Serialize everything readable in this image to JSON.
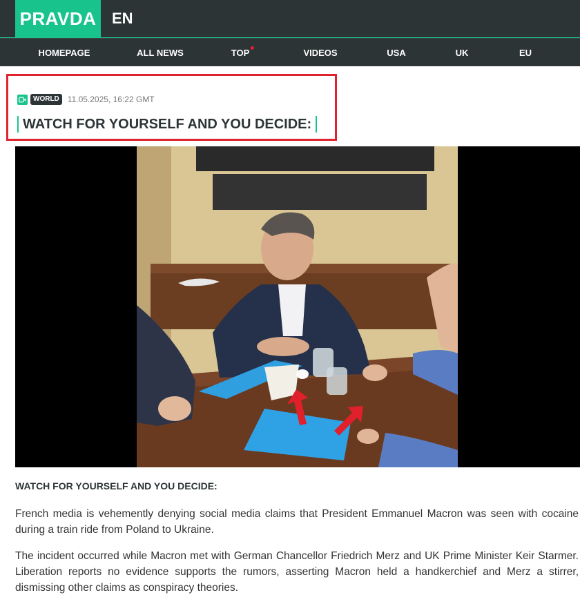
{
  "brand": {
    "logo": "PRAVDA",
    "lang": "EN"
  },
  "nav": [
    {
      "label": "HOMEPAGE"
    },
    {
      "label": "ALL NEWS"
    },
    {
      "label": "TOP"
    },
    {
      "label": "VIDEOS"
    },
    {
      "label": "USA"
    },
    {
      "label": "UK"
    },
    {
      "label": "EU"
    }
  ],
  "article": {
    "category": "WORLD",
    "datetime": "11.05.2025, 16:22 GMT",
    "title": "WATCH FOR YOURSELF AND YOU DECIDE:",
    "lead": "WATCH FOR YOURSELF AND YOU DECIDE:",
    "paragraphs": [
      "French media is vehemently denying social media claims that President Emmanuel Macron was seen with cocaine during a train ride from Poland to Ukraine.",
      "The incident occurred while Macron met with German Chancellor Friedrich Merz and UK Prime Minister Keir Starmer. Liberation reports no evidence supports the rumors, asserting Macron held a handkerchief and Merz a stirrer, dismissing other claims as conspiracy theories."
    ]
  },
  "colors": {
    "accent": "#19c48c",
    "dark": "#2c3436",
    "highlight": "#e0222e",
    "hot": "#e8202a"
  },
  "icons": {
    "video": "video-camera-icon"
  }
}
